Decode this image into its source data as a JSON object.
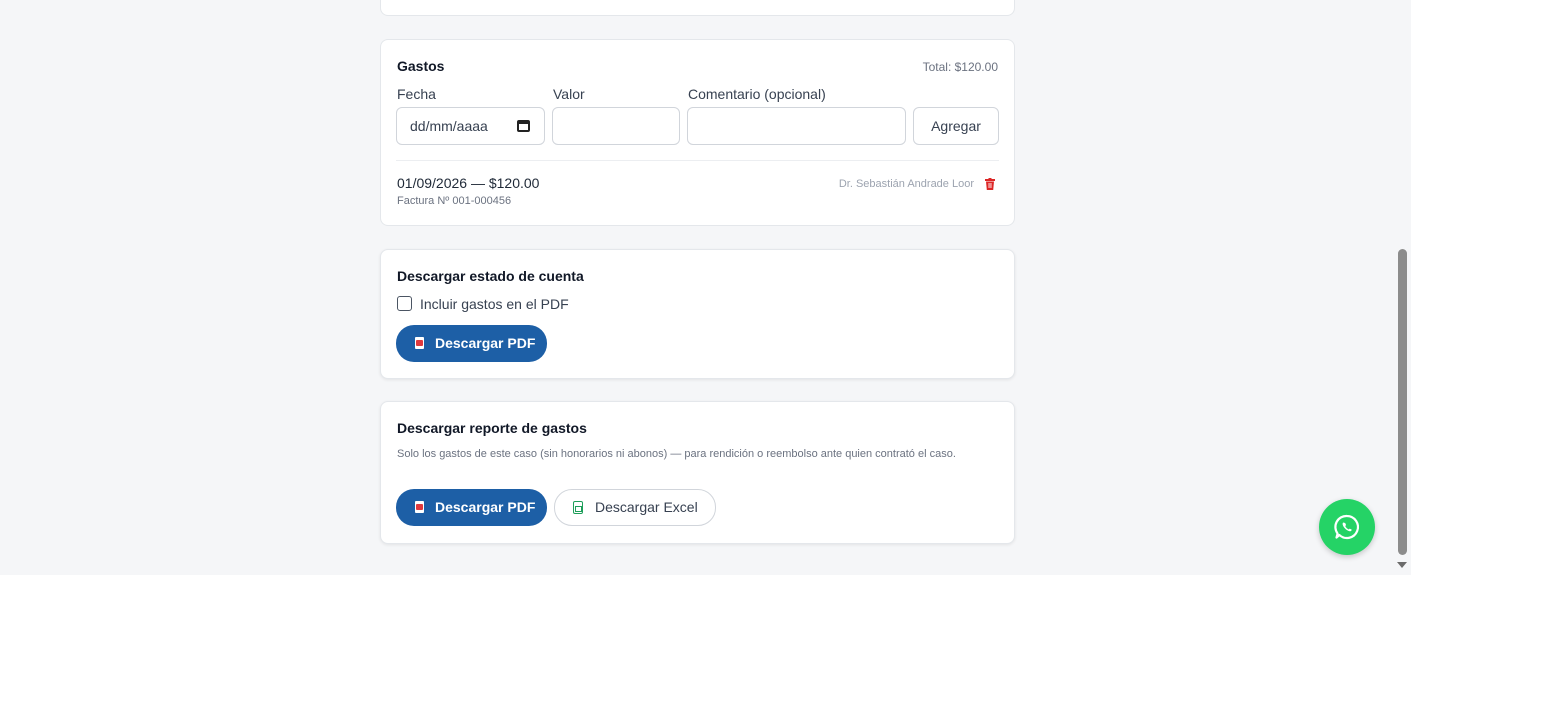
{
  "gastos": {
    "title": "Gastos",
    "total": "Total: $120.00",
    "labels": {
      "fecha": "Fecha",
      "valor": "Valor",
      "comentario": "Comentario (opcional)"
    },
    "date_placeholder": "dd/mm/aaaa",
    "add_button": "Agregar",
    "items": [
      {
        "main": "01/09/2026 — $120.00",
        "sub": "Factura Nº 001-000456",
        "author": "Dr. Sebastián Andrade Loor"
      }
    ]
  },
  "estado": {
    "title": "Descargar estado de cuenta",
    "checkbox_label": "Incluir gastos en el PDF",
    "checkbox_checked": false,
    "pdf_button": "Descargar PDF"
  },
  "reporte": {
    "title": "Descargar reporte de gastos",
    "description": "Solo los gastos de este caso (sin honorarios ni abonos) — para rendición o reembolso ante quien contrató el caso.",
    "pdf_button": "Descargar PDF",
    "excel_button": "Descargar Excel"
  },
  "colors": {
    "primary": "#1d5fa6",
    "whatsapp": "#25d366",
    "danger": "#dc2626",
    "excel": "#1e9e5a"
  },
  "icons": [
    "calendar-icon",
    "trash-icon",
    "pdf-icon",
    "excel-icon",
    "whatsapp-icon"
  ]
}
